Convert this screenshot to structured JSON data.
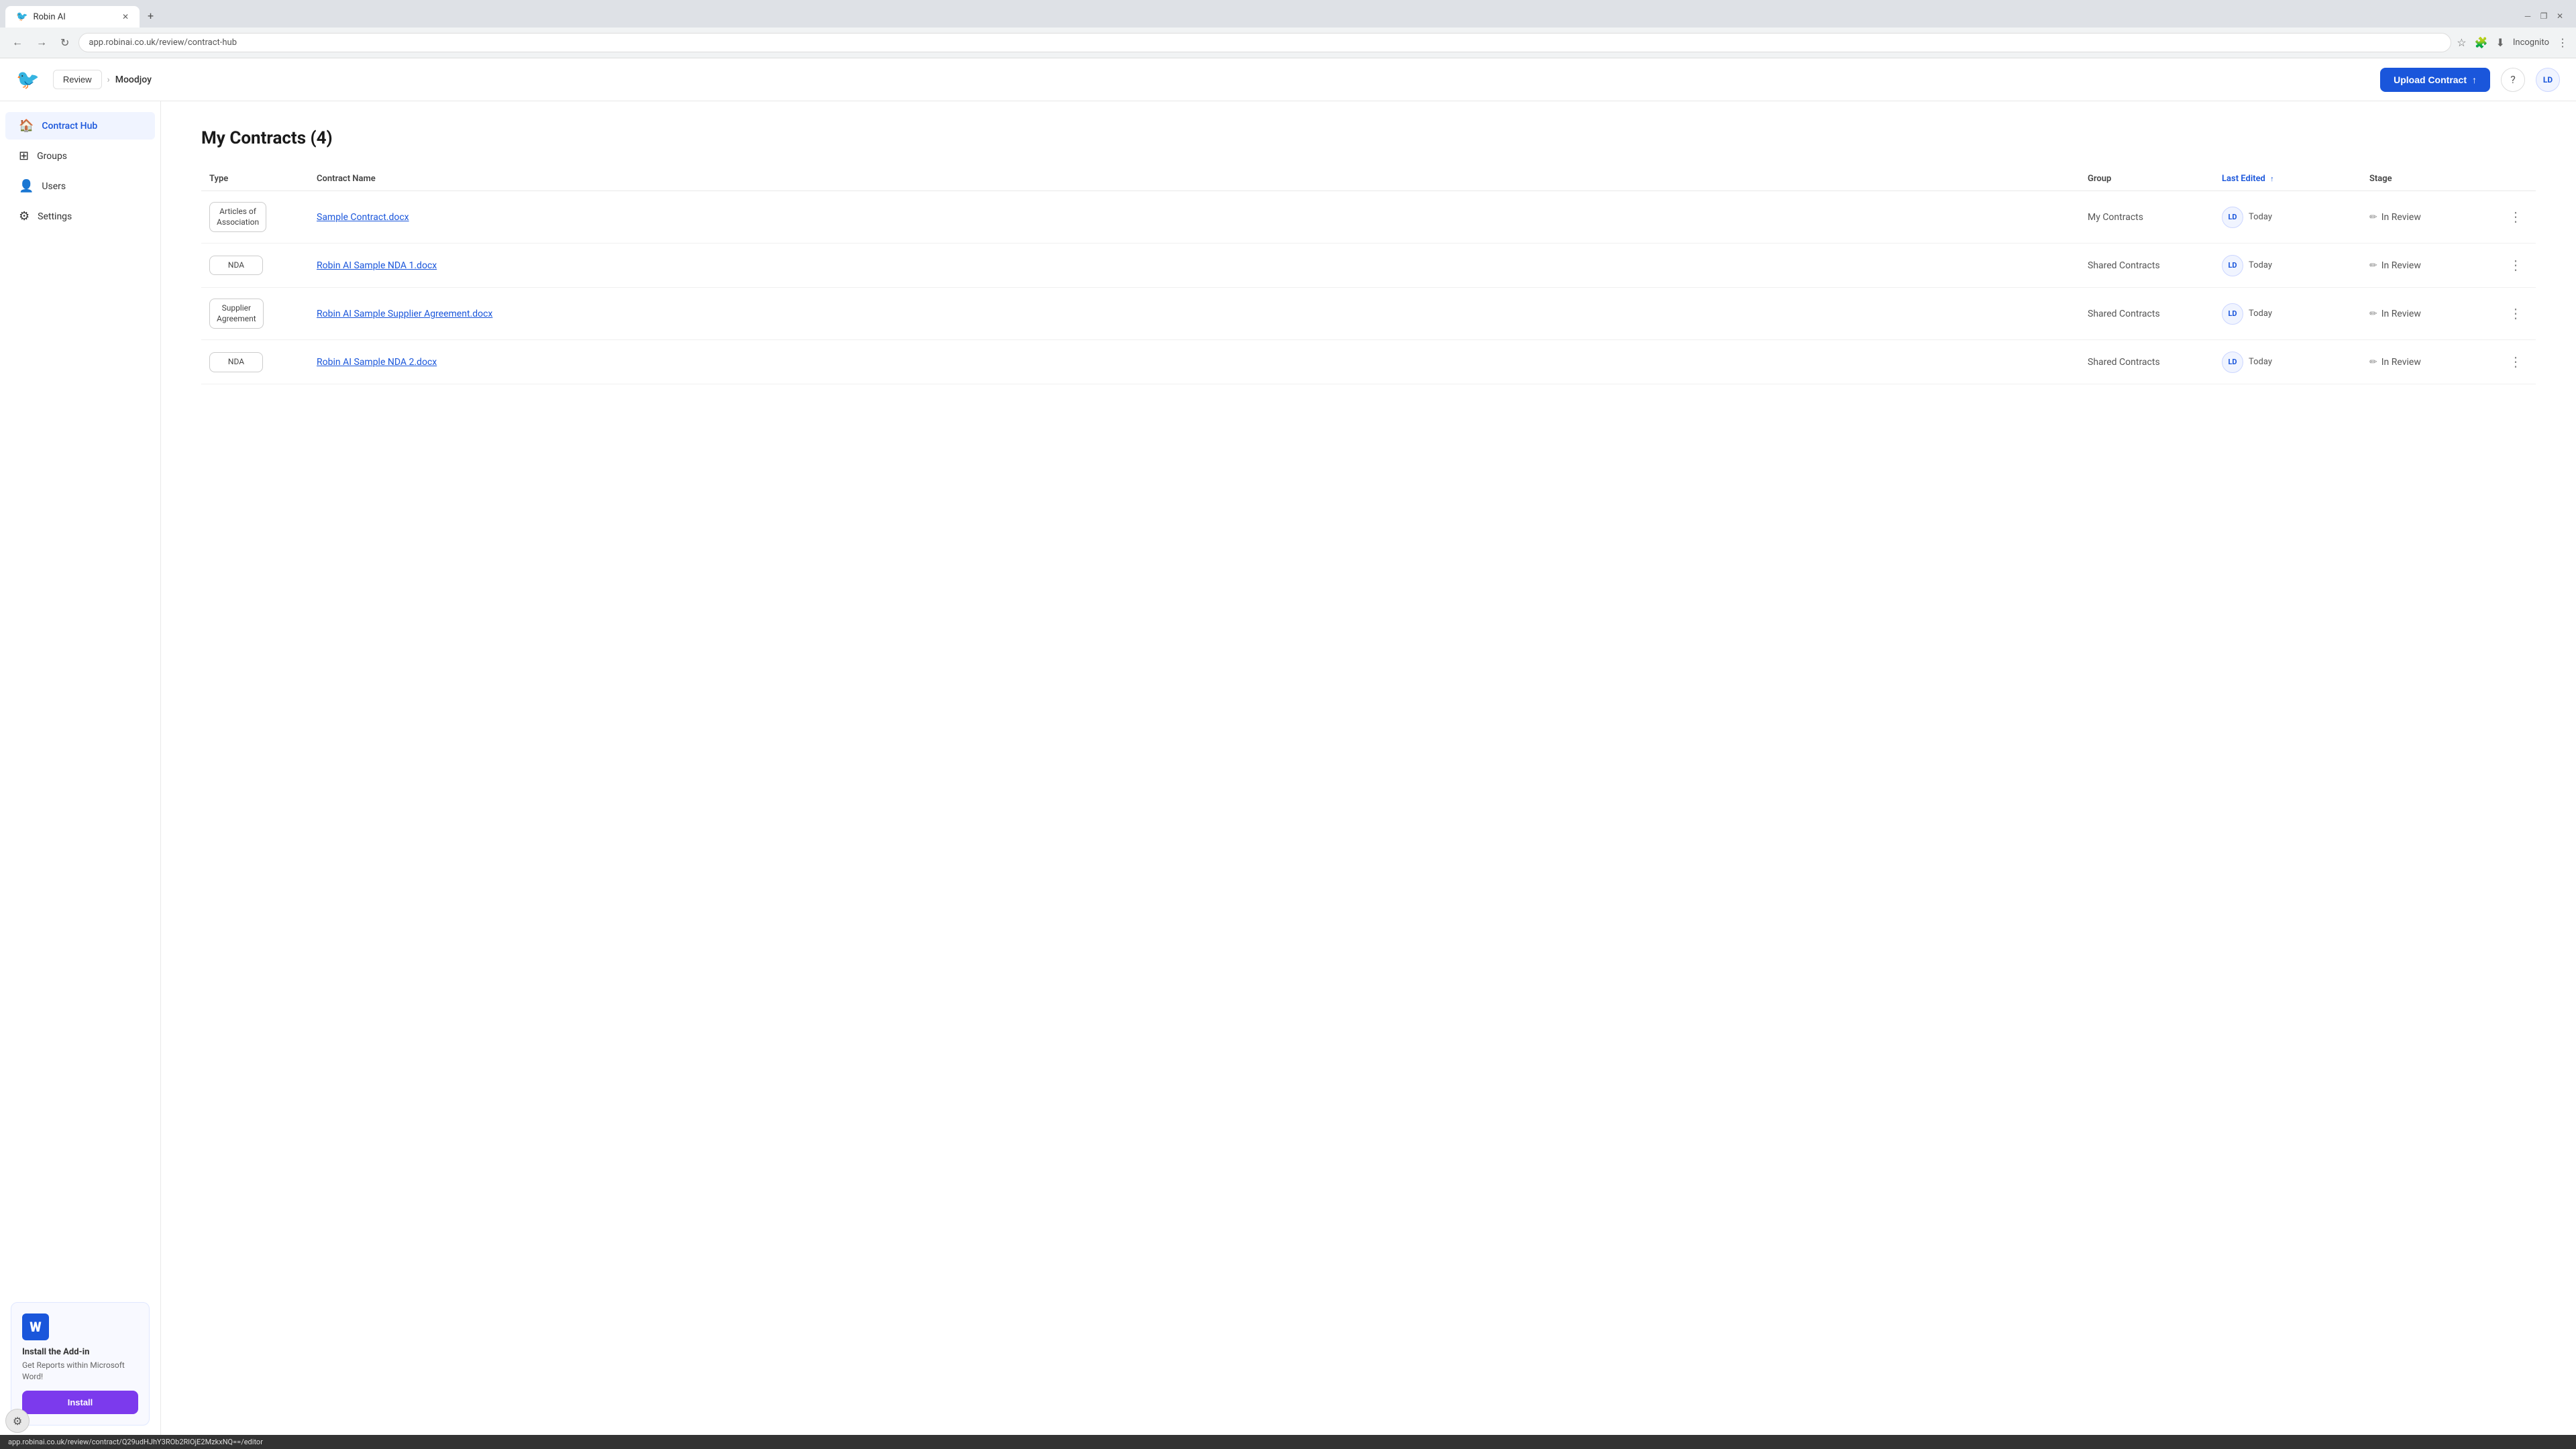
{
  "browser": {
    "tab_icon": "🐦",
    "tab_title": "Robin AI",
    "tab_close": "✕",
    "new_tab": "+",
    "win_minimize": "─",
    "win_restore": "❐",
    "win_close": "✕",
    "nav_back": "←",
    "nav_forward": "→",
    "nav_reload": "↻",
    "address": "app.robinai.co.uk/review/contract-hub",
    "toolbar_star": "☆",
    "toolbar_extensions": "🧩",
    "toolbar_download": "⬇",
    "toolbar_incognito": "Incognito",
    "toolbar_more": "⋮"
  },
  "header": {
    "review_label": "Review",
    "org_name": "Moodjoy",
    "upload_label": "Upload Contract",
    "help_icon": "?",
    "user_initials": "LD"
  },
  "sidebar": {
    "items": [
      {
        "label": "Contract Hub",
        "icon": "🏠",
        "active": true
      },
      {
        "label": "Groups",
        "icon": "⊞",
        "active": false
      },
      {
        "label": "Users",
        "icon": "👤",
        "active": false
      },
      {
        "label": "Settings",
        "icon": "⚙",
        "active": false
      }
    ],
    "addon": {
      "word_icon": "W",
      "title": "Install the Add-in",
      "description": "Get Reports within Microsoft Word!",
      "install_label": "Install"
    }
  },
  "main": {
    "page_title": "My Contracts (4)",
    "columns": {
      "type": "Type",
      "contract_name": "Contract Name",
      "group": "Group",
      "last_edited": "Last Edited",
      "stage": "Stage"
    },
    "contracts": [
      {
        "type": "Articles of\nAssociation",
        "contract_name": "Sample Contract.docx",
        "group": "My Contracts",
        "editor_initials": "LD",
        "edited_time": "Today",
        "stage": "In Review"
      },
      {
        "type": "NDA",
        "contract_name": "Robin AI Sample NDA 1.docx",
        "group": "Shared Contracts",
        "editor_initials": "LD",
        "edited_time": "Today",
        "stage": "In Review"
      },
      {
        "type": "Supplier\nAgreement",
        "contract_name": "Robin AI Sample Supplier Agreement.docx",
        "group": "Shared Contracts",
        "editor_initials": "LD",
        "edited_time": "Today",
        "stage": "In Review"
      },
      {
        "type": "NDA",
        "contract_name": "Robin AI Sample NDA 2.docx",
        "group": "Shared Contracts",
        "editor_initials": "LD",
        "edited_time": "Today",
        "stage": "In Review"
      }
    ]
  },
  "status_bar": {
    "url": "app.robinai.co.uk/review/contract/Q29udHJhY3ROb2RlOjE2MzkxNQ==/editor"
  },
  "corner_widget": {
    "icon": "⚙"
  }
}
